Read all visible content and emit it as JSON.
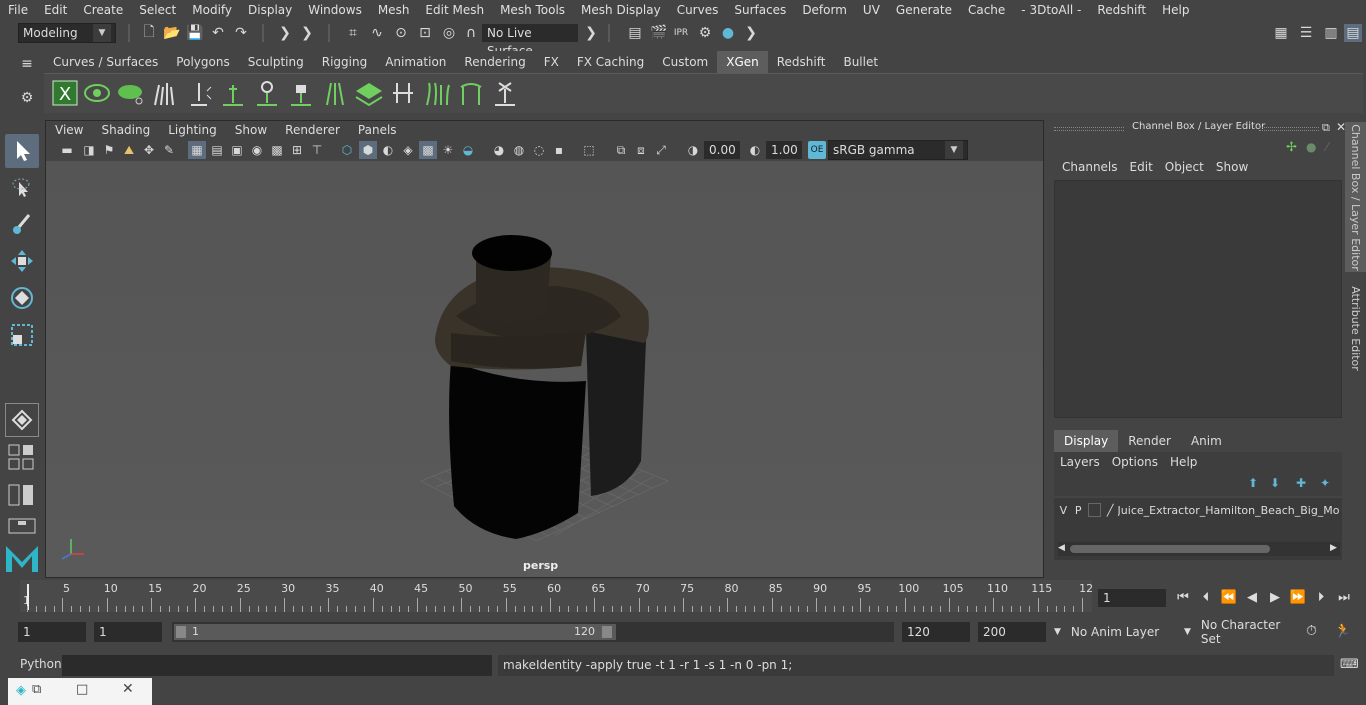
{
  "menubar": {
    "items": [
      "File",
      "Edit",
      "Create",
      "Select",
      "Modify",
      "Display",
      "Windows",
      "Mesh",
      "Edit Mesh",
      "Mesh Tools",
      "Mesh Display",
      "Curves",
      "Surfaces",
      "Deform",
      "UV",
      "Generate",
      "Cache",
      "- 3DtoAll -",
      "Redshift",
      "Help"
    ]
  },
  "statusline": {
    "mode": "Modeling",
    "live_surface": "No Live Surface"
  },
  "shelf": {
    "tabs": [
      "Curves / Surfaces",
      "Polygons",
      "Sculpting",
      "Rigging",
      "Animation",
      "Rendering",
      "FX",
      "FX Caching",
      "Custom",
      "XGen",
      "Redshift",
      "Bullet"
    ],
    "active_tab": "XGen"
  },
  "viewport": {
    "menu": [
      "View",
      "Shading",
      "Lighting",
      "Show",
      "Renderer",
      "Panels"
    ],
    "exposure": "0.00",
    "gamma": "1.00",
    "color_space": "sRGB gamma",
    "camera_label": "persp"
  },
  "channel_box": {
    "title": "Channel Box / Layer Editor",
    "menu": [
      "Channels",
      "Edit",
      "Object",
      "Show"
    ],
    "layer_tabs": [
      "Display",
      "Render",
      "Anim"
    ],
    "active_layer_tab": "Display",
    "layer_menu": [
      "Layers",
      "Options",
      "Help"
    ],
    "layer": {
      "v": "V",
      "p": "P",
      "name": "Juice_Extractor_Hamilton_Beach_Big_Mouth"
    }
  },
  "side_tabs": [
    "Channel Box / Layer Editor",
    "Attribute Editor"
  ],
  "timeline": {
    "ticks": [
      "5",
      "10",
      "15",
      "20",
      "25",
      "30",
      "35",
      "40",
      "45",
      "50",
      "55",
      "60",
      "65",
      "70",
      "75",
      "80",
      "85",
      "90",
      "95",
      "100",
      "105",
      "110",
      "115",
      "12"
    ],
    "start_label": "1",
    "current_frame": "1"
  },
  "range": {
    "start": "1",
    "playback_start": "1",
    "slider_start": "1",
    "slider_end": "120",
    "playback_end": "120",
    "end": "200",
    "anim_layer": "No Anim Layer",
    "character_set": "No Character Set"
  },
  "cmdline": {
    "language": "Python",
    "feedback": "makeIdentity -apply true -t 1 -r 1 -s 1 -n 0 -pn 1;"
  }
}
